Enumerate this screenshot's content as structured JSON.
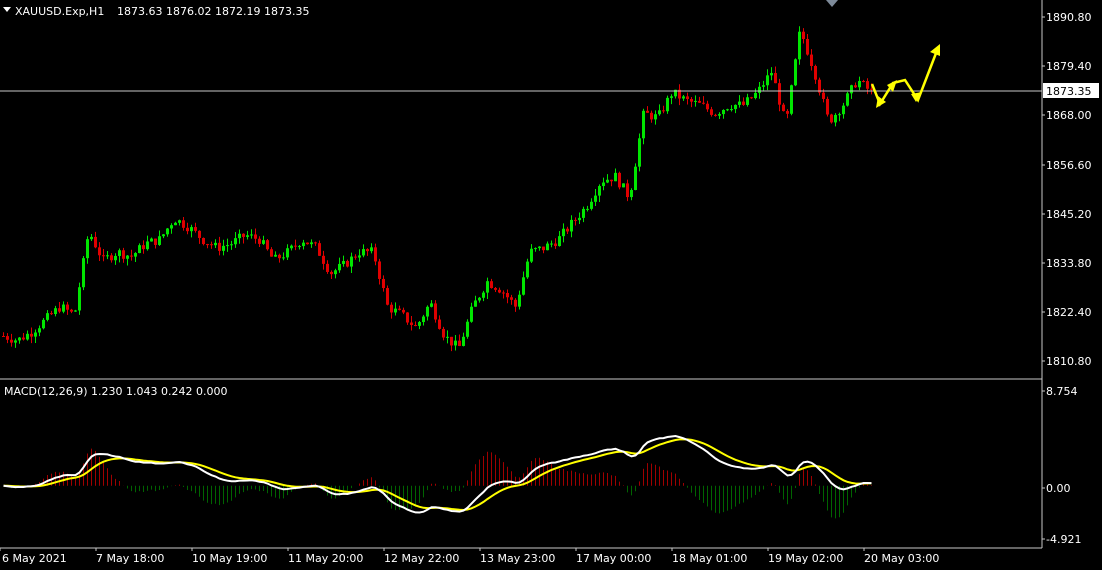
{
  "header": {
    "symbol_label": "XAUUSD.Exp,H1",
    "ohlc": "1873.63 1876.02 1872.19 1873.35"
  },
  "price_axis": {
    "labels": [
      "1890.80",
      "1879.40",
      "1868.00",
      "1856.60",
      "1845.20",
      "1833.80",
      "1822.40",
      "1810.80"
    ],
    "current_price_label": "1873.35"
  },
  "macd": {
    "label": "MACD(12,26,9) 1.230 1.043 0.242 0.000",
    "axis_labels": [
      "8.754",
      "0.00",
      "-4.921"
    ]
  },
  "time_axis": {
    "labels": [
      "6 May 2021",
      "7 May 18:00",
      "10 May 19:00",
      "11 May 20:00",
      "12 May 22:00",
      "13 May 23:00",
      "17 May 00:00",
      "18 May 01:00",
      "19 May 02:00",
      "20 May 03:00"
    ]
  },
  "colors": {
    "background": "#000000",
    "bull": "#00e600",
    "bear": "#e00000",
    "macd_main": "#ffffff",
    "macd_signal": "#ffff00",
    "hist_pos": "#a00000",
    "hist_neg": "#006400",
    "grid": "#c8c8c8",
    "forecast_arrow": "#ffff00"
  },
  "chart_data": {
    "type": "candlestick",
    "series": [
      {
        "name": "XAUUSD.Exp,H1",
        "close_trajectory": [
          1815,
          1814,
          1816,
          1819,
          1822,
          1820,
          1840,
          1833,
          1835,
          1834,
          1837,
          1838,
          1843,
          1841,
          1838,
          1836,
          1837,
          1839,
          1838,
          1833,
          1835,
          1838,
          1836,
          1830,
          1832,
          1835,
          1835,
          1822,
          1820,
          1817,
          1823,
          1815,
          1812,
          1822,
          1828,
          1826,
          1822,
          1835,
          1836,
          1838,
          1842,
          1846,
          1852,
          1853,
          1848,
          1868,
          1867,
          1873,
          1871,
          1870,
          1868,
          1870,
          1870,
          1873,
          1878,
          1865,
          1888,
          1878,
          1866,
          1870,
          1876,
          1873
        ]
      }
    ],
    "price_range": [
      1805,
      1895
    ],
    "macd_range": [
      -4.921,
      8.754
    ],
    "forecast": "yellow zigzag arrows pointing upward",
    "grid": false
  }
}
